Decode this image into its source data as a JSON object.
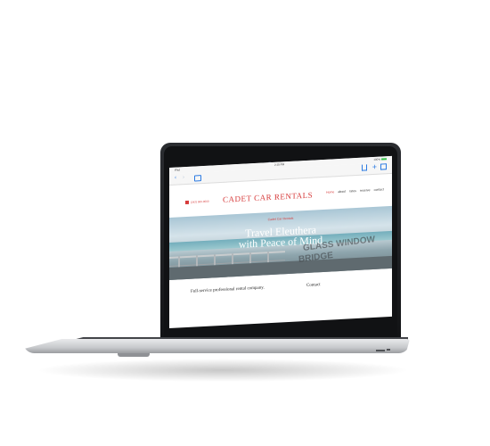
{
  "status_bar": {
    "carrier": "iPad",
    "time": "2:15 PM",
    "battery": "100%"
  },
  "browser": {
    "back_icon": "chevron-left-icon",
    "forward_icon": "chevron-right-icon"
  },
  "site": {
    "phone": "(242) 000-0000",
    "logo": "CADET CAR RENTALS",
    "nav": [
      "Home",
      "about",
      "rates",
      "reserve",
      "contact"
    ]
  },
  "hero": {
    "tagline": "Cadet Car Rentals",
    "title_line1": "Travel Eleuthera",
    "title_line2": "with Peace of Mind",
    "sign_line1": "GLASS WINDOW",
    "sign_line2": "BRIDGE"
  },
  "content": {
    "left_text": "Full-service professional rental company.",
    "right_text": "Contact"
  },
  "colors": {
    "accent": "#d63a3a",
    "link_blue": "#2a7ae2"
  }
}
